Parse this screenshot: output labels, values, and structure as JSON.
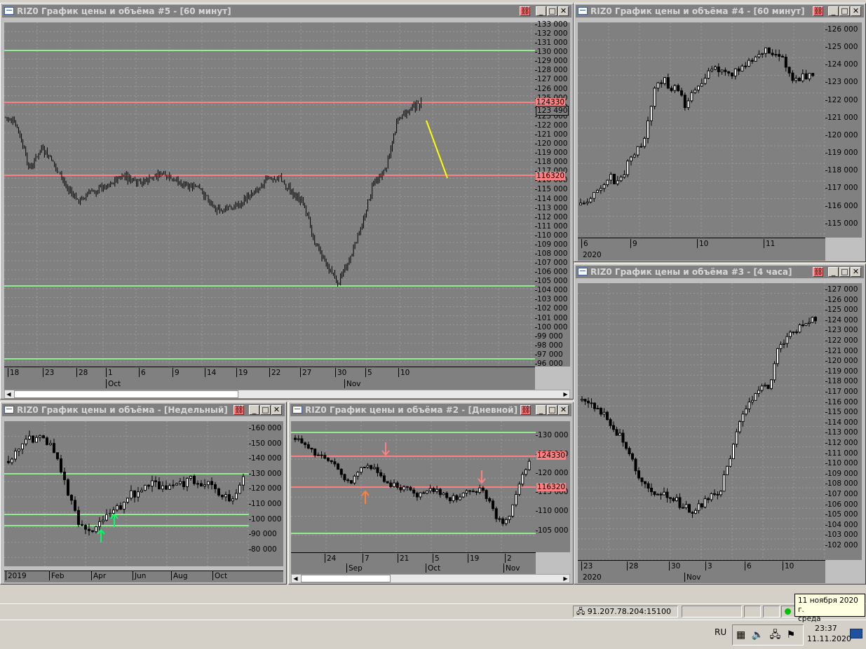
{
  "windows": {
    "w5": {
      "title": "RIZ0 График цены и объёма #5 - [60 минут]",
      "y_ticks": [
        "133 000",
        "132 000",
        "131 000",
        "130 000",
        "129 000",
        "128 000",
        "127 000",
        "126 000",
        "125 000",
        "124 000",
        "123 000",
        "122 000",
        "121 000",
        "120 000",
        "119 000",
        "118 000",
        "117 000",
        "116 000",
        "115 000",
        "114 000",
        "113 000",
        "112 000",
        "111 000",
        "110 000",
        "109 000",
        "108 000",
        "107 000",
        "106 000",
        "105 000",
        "104 000",
        "103 000",
        "102 000",
        "101 000",
        "100 000",
        "99 000",
        "98 000",
        "97 000",
        "96 000"
      ],
      "tag_red_1": "124330",
      "tag_box": "123 490",
      "tag_red_2": "116320",
      "x_days": [
        "18",
        "23",
        "28",
        "1",
        "6",
        "9",
        "14",
        "19",
        "22",
        "27",
        "30",
        "5",
        "10"
      ],
      "x_months": [
        "Oct",
        "Nov"
      ]
    },
    "w4": {
      "title": "RIZ0 График цены и объёма #4 - [60 минут]",
      "y_ticks": [
        "126 000",
        "125 000",
        "124 000",
        "123 000",
        "122 000",
        "121 000",
        "120 000",
        "119 000",
        "118 000",
        "117 000",
        "116 000",
        "115 000"
      ],
      "x_days": [
        "6",
        "9",
        "10",
        "11"
      ],
      "x_year": "2020"
    },
    "w3": {
      "title": "RIZ0 График цены и объёма #3 - [4 часа]",
      "y_ticks": [
        "127 000",
        "126 000",
        "125 000",
        "124 000",
        "123 000",
        "122 000",
        "121 000",
        "120 000",
        "119 000",
        "118 000",
        "117 000",
        "116 000",
        "115 000",
        "114 000",
        "113 000",
        "112 000",
        "111 000",
        "110 000",
        "109 000",
        "108 000",
        "107 000",
        "106 000",
        "105 000",
        "104 000",
        "103 000",
        "102 000"
      ],
      "x_days": [
        "23",
        "28",
        "30",
        "3",
        "6",
        "10"
      ],
      "x_year": "2020",
      "x_months": [
        "Nov"
      ]
    },
    "wweek": {
      "title": "RIZ0 График цены и объёма - [Недельный]",
      "y_ticks": [
        "160 000",
        "150 000",
        "140 000",
        "130 000",
        "120 000",
        "110 000",
        "100 000",
        "90 000",
        "80 000"
      ],
      "x_labels": [
        "2019",
        "Feb",
        "Apr",
        "Jun",
        "Aug",
        "Oct"
      ]
    },
    "w2": {
      "title": "RIZ0 График цены и объёма #2 - [Дневной]",
      "y_ticks": [
        "130 000",
        "125 000",
        "120 000",
        "115 000",
        "110 000",
        "105 000"
      ],
      "tag_red_1": "124330",
      "tag_red_2": "116320",
      "x_days": [
        "24",
        "7",
        "21",
        "5",
        "19",
        "2"
      ],
      "x_months": [
        "Sep",
        "Oct",
        "Nov"
      ]
    }
  },
  "status": {
    "server": "91.207.78.204:15100"
  },
  "tooltip": {
    "line1": "11 ноября 2020 г.",
    "line2": "среда"
  },
  "taskbar": {
    "lang": "RU",
    "time": "23:37",
    "date": "11.11.2020"
  },
  "colors": {
    "chart_bg": "#808080",
    "resistance": "#ff8080",
    "support": "#90ee90",
    "forecast": "#ffff00",
    "arrow_green": "#00ff60",
    "arrow_red": "#ff8080",
    "arrow_orange": "#ff8040"
  }
}
